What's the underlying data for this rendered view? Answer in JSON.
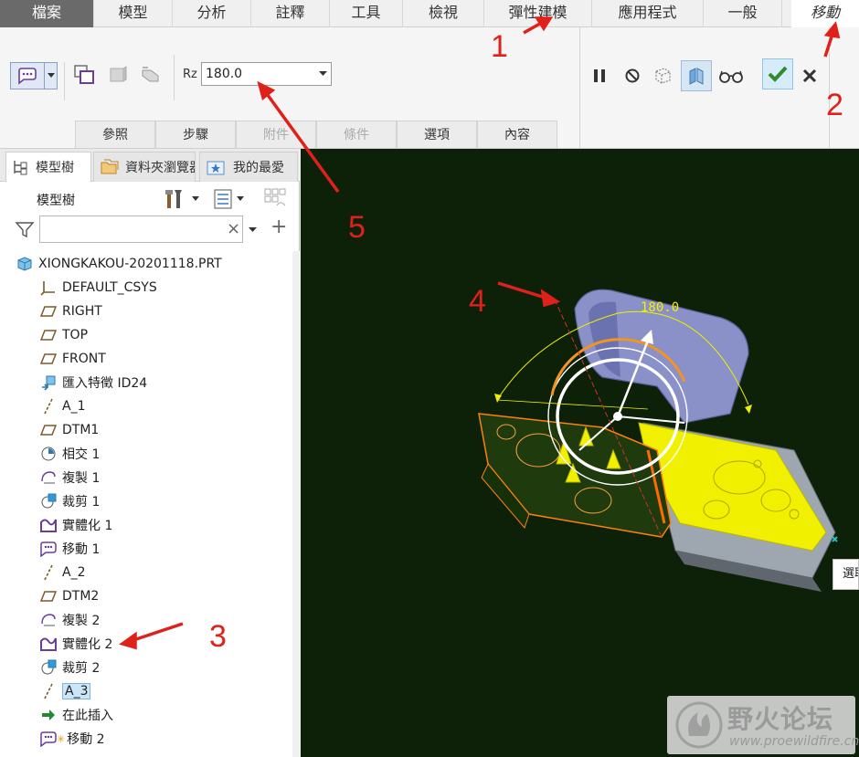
{
  "menu": {
    "items": [
      "檔案",
      "模型",
      "分析",
      "註釋",
      "工具",
      "檢視",
      "彈性建模",
      "應用程式",
      "一般"
    ],
    "active_tab": "移動"
  },
  "ribbon": {
    "rz_label": "Rz",
    "rz_value": "180.0",
    "subtabs": [
      "參照",
      "步驟",
      "附件",
      "條件",
      "選項",
      "內容"
    ]
  },
  "panel": {
    "tabs": [
      "模型樹",
      "資料夾瀏覽器",
      "我的最愛"
    ],
    "tree_title": "模型樹",
    "search_value": "",
    "clear_symbol": "×",
    "add_symbol": "+"
  },
  "tree": {
    "nodes": [
      {
        "label": "XIONGKAKOU-20201118.PRT",
        "icon": "part-icon"
      },
      {
        "label": "DEFAULT_CSYS",
        "icon": "csys-icon"
      },
      {
        "label": "RIGHT",
        "icon": "datum-plane-icon"
      },
      {
        "label": "TOP",
        "icon": "datum-plane-icon"
      },
      {
        "label": "FRONT",
        "icon": "datum-plane-icon"
      },
      {
        "label": "匯入特徵 ID24",
        "icon": "import-feature-icon"
      },
      {
        "label": "A_1",
        "icon": "datum-axis-icon"
      },
      {
        "label": "DTM1",
        "icon": "datum-plane-icon"
      },
      {
        "label": "相交 1",
        "icon": "intersect-icon"
      },
      {
        "label": "複製 1",
        "icon": "copy-icon"
      },
      {
        "label": "裁剪 1",
        "icon": "trim-icon"
      },
      {
        "label": "實體化 1",
        "icon": "solidify-icon"
      },
      {
        "label": "移動 1",
        "icon": "move-icon"
      },
      {
        "label": "A_2",
        "icon": "datum-axis-icon"
      },
      {
        "label": "DTM2",
        "icon": "datum-plane-icon"
      },
      {
        "label": "複製 2",
        "icon": "copy-icon"
      },
      {
        "label": "實體化 2",
        "icon": "solidify-icon"
      },
      {
        "label": "裁剪 2",
        "icon": "trim-icon"
      },
      {
        "label": "A_3",
        "icon": "datum-axis-icon"
      },
      {
        "label": "在此插入",
        "icon": "insert-here-icon"
      },
      {
        "label": "移動 2",
        "icon": "move-icon"
      }
    ]
  },
  "viewport": {
    "dimension_label": "180.0",
    "tooltip_text": "選取"
  },
  "annotations": [
    "1",
    "2",
    "3",
    "4",
    "5"
  ],
  "watermark": {
    "text_cn": "野火论坛",
    "url": "www.proewildfire.cn"
  },
  "colors": {
    "accent_green": "#2e8b2e",
    "highlight_yellow": "#f0f000",
    "viewport_bg": "#0d2008",
    "annotation_red": "#e0201a"
  }
}
